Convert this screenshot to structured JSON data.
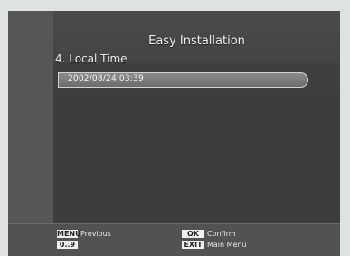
{
  "screen": {
    "title": "Easy Installation",
    "step_label": "4. Local Time",
    "selected_value": "2002/08/24 03:39"
  },
  "footer": {
    "menu_key": "MENU",
    "menu_label": "Previous",
    "digits_key": "0..9",
    "ok_key": "OK",
    "ok_label": "Confirm",
    "exit_key": "EXIT",
    "exit_label": "Main Menu"
  },
  "colors": {
    "screen_bg": "#3f3f3f",
    "left_strip": "#565656",
    "highlight": "#7a7a7a",
    "key_bg": "#f0f0f0"
  }
}
